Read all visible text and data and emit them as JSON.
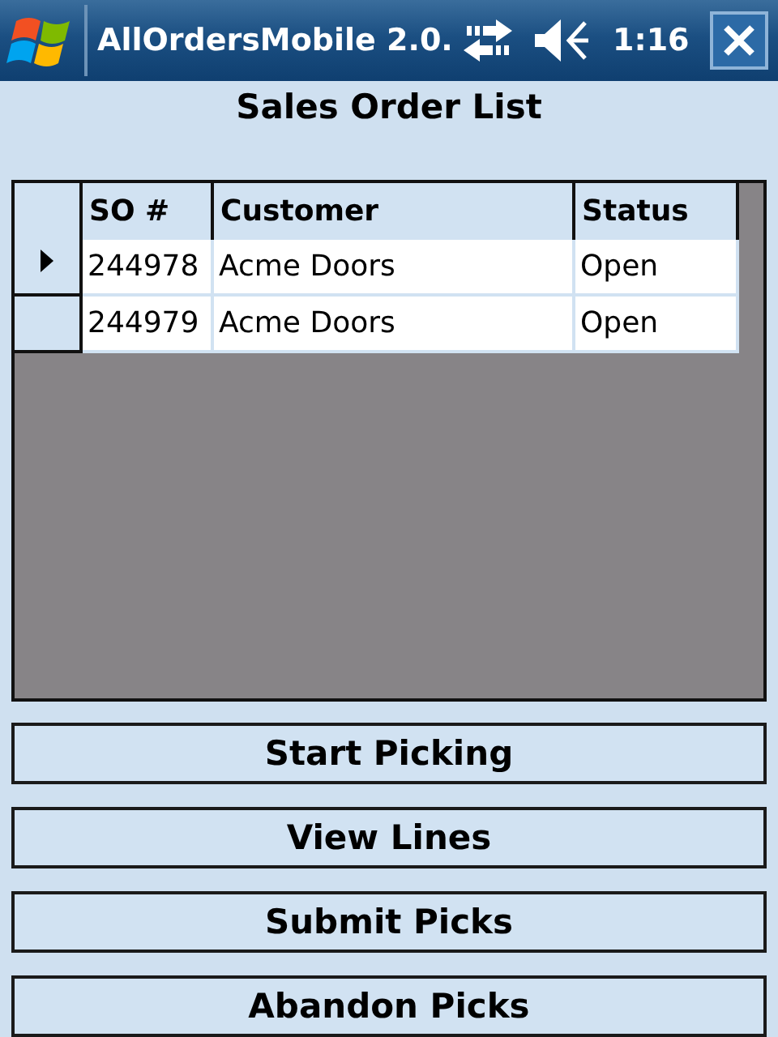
{
  "window": {
    "title": "AllOrdersMobile 2.0.",
    "time": "1:16"
  },
  "heading": "Sales Order List",
  "table": {
    "columns": [
      "SO #",
      "Customer",
      "Status"
    ],
    "rows": [
      {
        "selected": true,
        "cells": [
          "244978",
          "Acme Doors",
          "Open"
        ]
      },
      {
        "selected": false,
        "cells": [
          "244979",
          "Acme Doors",
          "Open"
        ]
      }
    ]
  },
  "buttons": [
    "Start Picking",
    "View Lines",
    "Submit Picks",
    "Abandon Picks"
  ]
}
